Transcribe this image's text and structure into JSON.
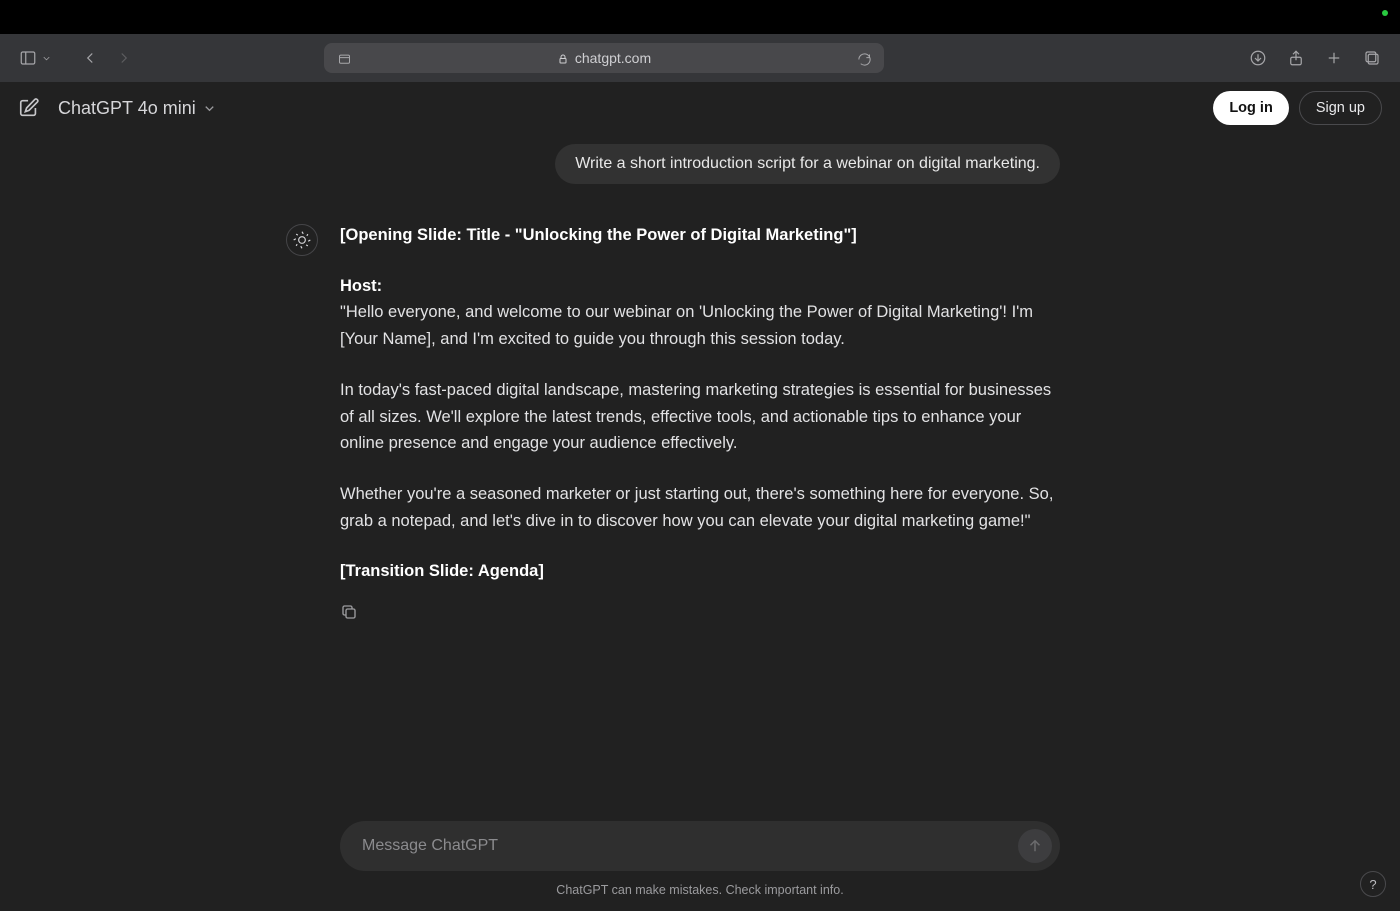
{
  "browser": {
    "url_display": "chatgpt.com"
  },
  "header": {
    "model_label": "ChatGPT 4o mini",
    "login_label": "Log in",
    "signup_label": "Sign up"
  },
  "conversation": {
    "user_message": "Write a short introduction script for a webinar on digital marketing.",
    "assistant": {
      "line_opening_slide": "[Opening Slide: Title - \"Unlocking the Power of Digital Marketing\"]",
      "host_label": "Host:",
      "para1": "\"Hello everyone, and welcome to our webinar on 'Unlocking the Power of Digital Marketing'! I'm [Your Name], and I'm excited to guide you through this session today.",
      "para2": "In today's fast-paced digital landscape, mastering marketing strategies is essential for businesses of all sizes. We'll explore the latest trends, effective tools, and actionable tips to enhance your online presence and engage your audience effectively.",
      "para3": "Whether you're a seasoned marketer or just starting out, there's something here for everyone. So, grab a notepad, and let's dive in to discover how you can elevate your digital marketing game!\"",
      "line_transition_slide": "[Transition Slide: Agenda]"
    }
  },
  "composer": {
    "placeholder": "Message ChatGPT"
  },
  "footer": {
    "disclaimer": "ChatGPT can make mistakes. Check important info.",
    "help_label": "?"
  }
}
